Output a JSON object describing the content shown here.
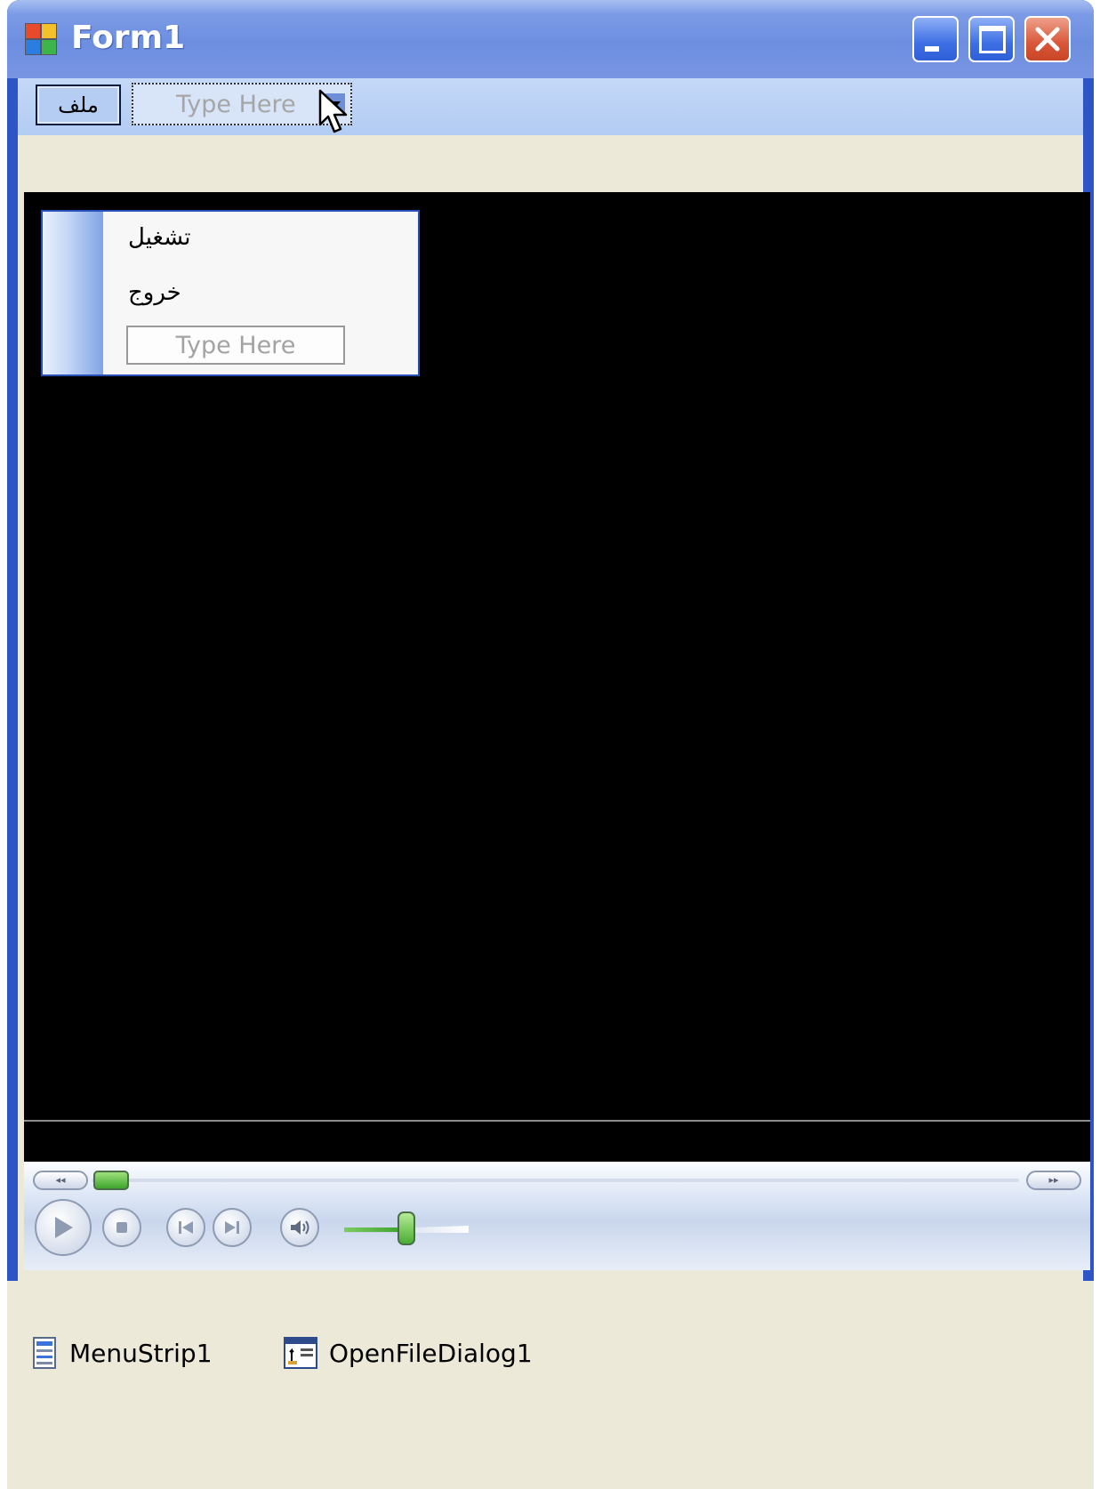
{
  "window": {
    "title": "Form1",
    "controls": {
      "minimize": "minimize-icon",
      "maximize": "maximize-icon",
      "close": "close-icon"
    }
  },
  "menustrip": {
    "items": [
      {
        "label": "ملف",
        "state": "open"
      }
    ],
    "type_here": "Type Here",
    "dropdown": {
      "items": [
        {
          "label": "تشغيل"
        },
        {
          "label": "خروج"
        }
      ],
      "type_here": "Type Here"
    }
  },
  "player": {
    "seek_progress": 0,
    "volume_level": 0.5,
    "buttons": [
      "play-icon",
      "stop-icon",
      "previous-icon",
      "next-icon",
      "mute-icon"
    ]
  },
  "tray": {
    "items": [
      {
        "label": "MenuStrip1",
        "icon": "menustrip-icon"
      },
      {
        "label": "OpenFileDialog1",
        "icon": "openfiledialog-icon"
      }
    ]
  },
  "colors": {
    "title_bar": "#6d8ee0",
    "menu_strip": "#b3ccf3",
    "client_background": "#ece9d8",
    "player_background": "#000000",
    "close_button": "#d9573a"
  }
}
